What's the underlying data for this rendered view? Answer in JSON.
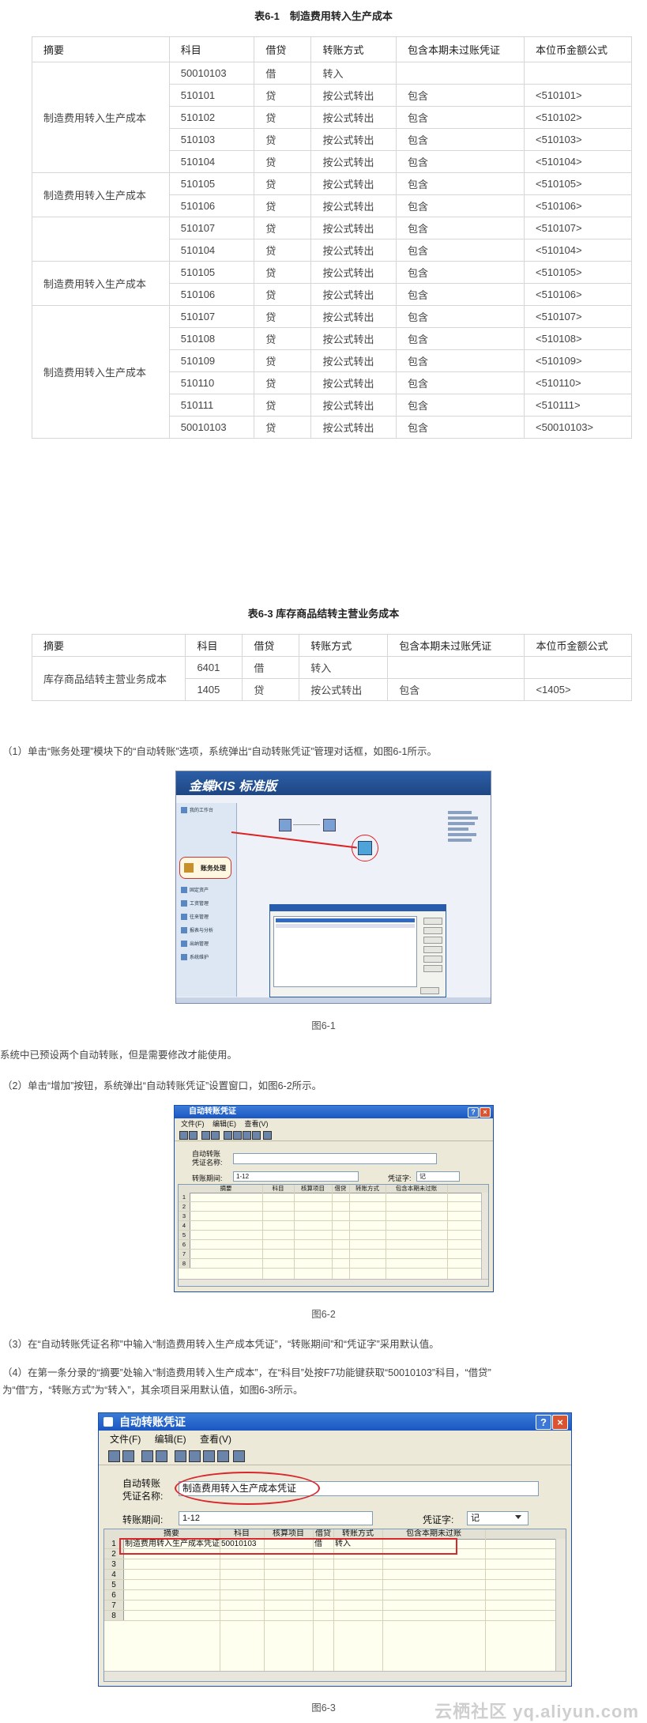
{
  "table1": {
    "caption": "表6-1　制造费用转入生产成本",
    "headers": [
      "摘要",
      "科目",
      "借贷",
      "转账方式",
      "包含本期未过账凭证",
      "本位币金额公式"
    ],
    "groups": [
      {
        "summary": "制造费用转入生产成本",
        "rows": [
          [
            "50010103",
            "借",
            "转入",
            "",
            ""
          ],
          [
            "510101",
            "贷",
            "按公式转出",
            "包含",
            "<510101>"
          ],
          [
            "510102",
            "贷",
            "按公式转出",
            "包含",
            "<510102>"
          ],
          [
            "510103",
            "贷",
            "按公式转出",
            "包含",
            "<510103>"
          ],
          [
            "510104",
            "贷",
            "按公式转出",
            "包含",
            "<510104>"
          ]
        ]
      },
      {
        "summary": "制造费用转入生产成本",
        "rows": [
          [
            "510105",
            "贷",
            "按公式转出",
            "包含",
            "<510105>"
          ],
          [
            "510106",
            "贷",
            "按公式转出",
            "包含",
            "<510106>"
          ]
        ]
      },
      {
        "summary": "",
        "rows": [
          [
            "510107",
            "贷",
            "按公式转出",
            "包含",
            "<510107>"
          ],
          [
            "510104",
            "贷",
            "按公式转出",
            "包含",
            "<510104>"
          ]
        ]
      },
      {
        "summary": "制造费用转入生产成本",
        "rows": [
          [
            "510105",
            "贷",
            "按公式转出",
            "包含",
            "<510105>"
          ],
          [
            "510106",
            "贷",
            "按公式转出",
            "包含",
            "<510106>"
          ]
        ]
      },
      {
        "summary": "制造费用转入生产成本",
        "rows": [
          [
            "510107",
            "贷",
            "按公式转出",
            "包含",
            "<510107>"
          ],
          [
            "510108",
            "贷",
            "按公式转出",
            "包含",
            "<510108>"
          ],
          [
            "510109",
            "贷",
            "按公式转出",
            "包含",
            "<510109>"
          ],
          [
            "510110",
            "贷",
            "按公式转出",
            "包含",
            "<510110>"
          ],
          [
            "510111",
            "贷",
            "按公式转出",
            "包含",
            "<510111>"
          ],
          [
            "50010103",
            "贷",
            "按公式转出",
            "包含",
            "<50010103>"
          ]
        ]
      }
    ]
  },
  "table2": {
    "caption": "表6-3 库存商品结转主营业务成本",
    "headers": [
      "摘要",
      "科目",
      "借贷",
      "转账方式",
      "包含本期未过账凭证",
      "本位币金额公式"
    ],
    "groups": [
      {
        "summary": "库存商品结转主营业务成本",
        "rows": [
          [
            "6401",
            "借",
            "转入",
            "",
            ""
          ],
          [
            "1405",
            "贷",
            "按公式转出",
            "包含",
            "<1405>"
          ]
        ]
      }
    ]
  },
  "paragraphs": {
    "p1": "（1）单击“账务处理”模块下的“自动转账”选项，系统弹出“自动转账凭证”管理对话框，如图6-1所示。",
    "p2": "系统中已预设两个自动转账，但是需要修改才能使用。",
    "p3": "（2）单击“增加”按钮，系统弹出“自动转账凭证”设置窗口，如图6-2所示。",
    "p4": "（3）在“自动转账凭证名称”中输入“制造费用转入生产成本凭证”，“转账期间”和“凭证字”采用默认值。",
    "p5a": "（4）在第一条分录的“摘要”处输入“制造费用转入生产成本”，在“科目”处按F7功能键获取“50010103”科目，“借贷”",
    "p5b": "为“借”方，“转账方式”为“转入”，其余项目采用默认值，如图6-3所示。"
  },
  "figures": {
    "fig1_caption": "图6-1",
    "fig2_caption": "图6-2",
    "fig3_caption": "图6-3"
  },
  "fig1": {
    "logo": "金蝶KIS 标准版",
    "nav": [
      "我的工作台",
      "账务处理",
      "固定资产",
      "工资管理",
      "往来管理",
      "报表与分析",
      "出纳管理",
      "系统维护"
    ],
    "selected_nav": "账务处理"
  },
  "dialog": {
    "title": "自动转账凭证",
    "menu": [
      "文件(F)",
      "编辑(E)",
      "查看(V)"
    ],
    "name_label_1": "自动转账",
    "name_label_2": "凭证名称:",
    "period_label": "转账期间:",
    "period_value": "1-12",
    "voucher_label": "凭证字:",
    "voucher_value": "记",
    "columns": [
      "摘要",
      "科目",
      "核算项目",
      "借贷",
      "转账方式",
      "包含本期未过账"
    ],
    "row_numbers": [
      "1",
      "2",
      "3",
      "4",
      "5",
      "6",
      "7",
      "8"
    ]
  },
  "fig3": {
    "name_value": "制造费用转入生产成本凭证",
    "row1": {
      "summary": "制造费用转入生产成本凭证",
      "account": "50010103",
      "direction": "借",
      "method": "转入"
    }
  },
  "watermark": "云栖社区 yq.aliyun.com",
  "colors": {
    "accent_red": "#d9272e",
    "title_blue": "#1b56c2"
  }
}
